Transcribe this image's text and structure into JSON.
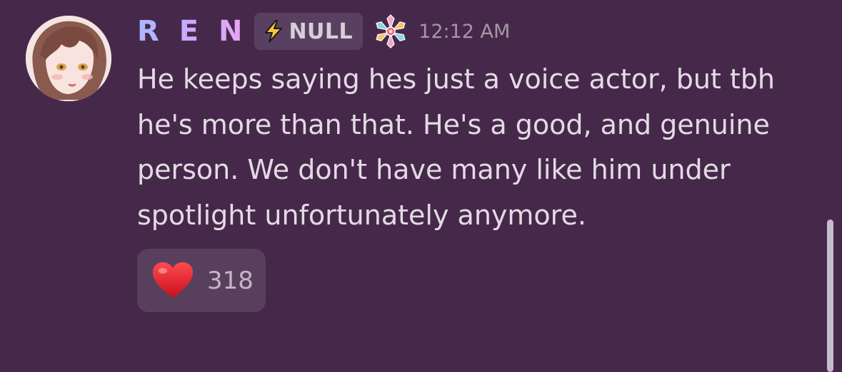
{
  "message": {
    "author": {
      "username": "R E N",
      "tag_label": "NULL",
      "tag_icon": "lightning-bolt-icon",
      "role_icon": "crystal-flower-icon",
      "avatar_icon": "anime-avatar-icon"
    },
    "timestamp": "12:12 AM",
    "content_lines": [
      "He keeps saying hes just a voice actor, but tbh",
      "he's more than that. He's a good, and genuine",
      "person. We don't have many like him under",
      "spotlight unfortunately anymore."
    ],
    "reactions": [
      {
        "emoji_icon": "red-heart-icon",
        "count": "318"
      }
    ]
  },
  "colors": {
    "background": "#46294a",
    "username_gradient": [
      "#a9b7ff",
      "#e8a6f2"
    ],
    "tag_background": "#5a4060",
    "text": "#e3dbe4",
    "timestamp": "#a696a8",
    "reaction_background": "#58405d",
    "heart": "#e0242e"
  }
}
